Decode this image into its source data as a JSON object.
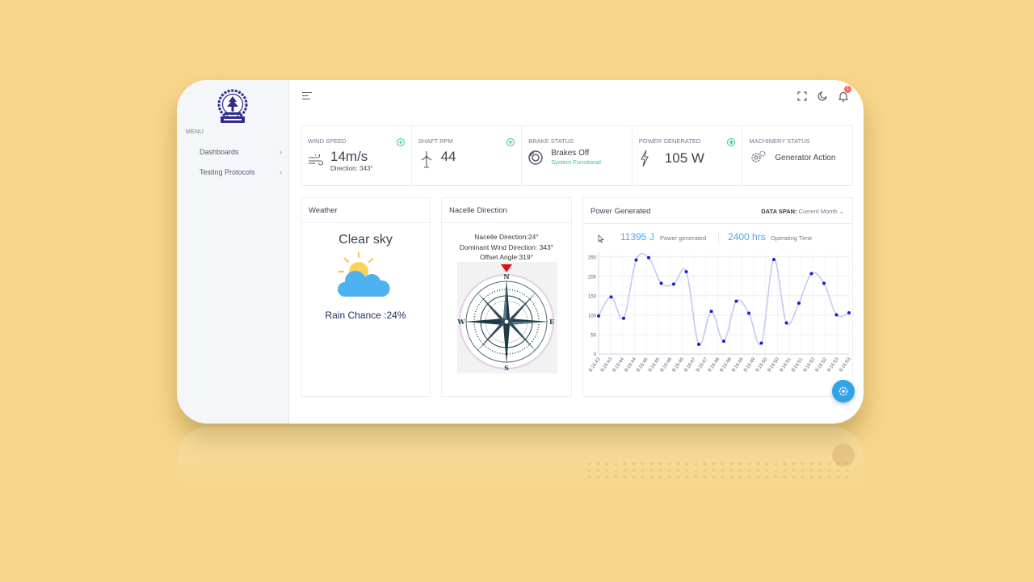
{
  "sidebar": {
    "menu_title": "MENU",
    "items": [
      {
        "label": "Dashboards"
      },
      {
        "label": "Testing Protocols"
      }
    ]
  },
  "topbar": {
    "icons": [
      "menu-icon",
      "fullscreen-icon",
      "moon-icon",
      "bell-icon"
    ],
    "notification_count": "1"
  },
  "stats": {
    "wind_speed": {
      "label": "WIND SPEED",
      "value": "14m/s",
      "sub": "Direction: 343°"
    },
    "shaft_rpm": {
      "label": "SHAFT RPM",
      "value": "44"
    },
    "brake_status": {
      "label": "BRAKE STATUS",
      "value": "Brakes Off",
      "sub": "System Functional"
    },
    "power_generated": {
      "label": "POWER GENERATED",
      "value": "105 W"
    },
    "machinery_status": {
      "label": "MACHINERY STATUS",
      "value": "Generator Action"
    }
  },
  "weather": {
    "title": "Weather",
    "condition": "Clear sky",
    "rain_chance": "Rain Chance :24%"
  },
  "nacelle": {
    "title": "Nacelle Direction",
    "lines": [
      "Nacelle Direction:24°",
      "Dominant Wind Direction: 343°",
      "Offset Angle:319°"
    ],
    "cardinals": {
      "n": "N",
      "e": "E",
      "s": "S",
      "w": "W"
    }
  },
  "power": {
    "title": "Power Generated",
    "span_label": "DATA SPAN:",
    "span_value": "Current Month",
    "energy_value": "11395 J",
    "energy_label": "Power generated",
    "hours_value": "2400 hrs",
    "hours_label": "Operating Time"
  },
  "colors": {
    "accent": "#50a5f1",
    "success": "#34c38f",
    "point": "#1a1adb",
    "line": "#c5c9f2",
    "fab": "#2fa4e7"
  },
  "chart_data": {
    "type": "line",
    "x": [
      "9:16:43",
      "9:16:43",
      "9:16:44",
      "9:16:44",
      "9:16:45",
      "9:16:45",
      "9:16:46",
      "9:16:46",
      "9:16:47",
      "9:16:47",
      "9:16:48",
      "9:16:48",
      "9:16:49",
      "9:16:49",
      "9:16:50",
      "9:16:50",
      "9:16:51",
      "9:16:51",
      "9:16:52",
      "9:16:52",
      "9:16:53",
      "9:16:53"
    ],
    "values": [
      98,
      147,
      92,
      242,
      248,
      182,
      180,
      212,
      25,
      110,
      33,
      136,
      105,
      28,
      243,
      80,
      131,
      207,
      182,
      101,
      106
    ],
    "yticks": [
      0,
      50,
      100,
      150,
      200,
      250
    ],
    "ylim": [
      0,
      260
    ],
    "grid": true,
    "smooth": true
  }
}
